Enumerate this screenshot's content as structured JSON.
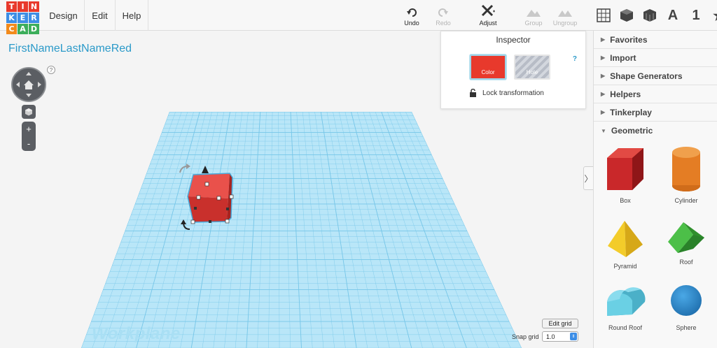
{
  "app": {
    "logo_letters": [
      "T",
      "I",
      "N",
      "K",
      "E",
      "R",
      "C",
      "A",
      "D"
    ],
    "logo_colors": [
      "#e8392c",
      "#e8392c",
      "#e8392c",
      "#3d8ee6",
      "#3d8ee6",
      "#3d8ee6",
      "#f28a1b",
      "#3cae5b",
      "#3cae5b"
    ],
    "menus": [
      "Design",
      "Edit",
      "Help"
    ]
  },
  "toolbar": {
    "undo": "Undo",
    "redo": "Redo",
    "adjust": "Adjust",
    "group": "Group",
    "ungroup": "Ungroup",
    "view_icons": [
      "grid-view-icon",
      "box-view-icon",
      "brick-icon"
    ],
    "text_tool": "A",
    "number_tool": "1",
    "favorite_icon": "★"
  },
  "design": {
    "title": "FirstNameLastNameRed"
  },
  "view_controls": {
    "help": "?",
    "zoom_in": "+",
    "zoom_out": "-"
  },
  "workplane": {
    "label": "Workplane",
    "color": "#b9e6f8",
    "line_color": "#76c6e8"
  },
  "inspector": {
    "title": "Inspector",
    "color_label": "Color",
    "hole_label": "Hole",
    "help": "?",
    "lock_label": "Lock transformation",
    "selected_color": "#e8392c"
  },
  "panel": {
    "sections": [
      "Favorites",
      "Import",
      "Shape Generators",
      "Helpers",
      "Tinkerplay",
      "Geometric"
    ],
    "shapes": [
      {
        "label": "Box",
        "color": "#d2282a"
      },
      {
        "label": "Cylinder",
        "color": "#e6781a"
      },
      {
        "label": "Pyramid",
        "color": "#f0c81e"
      },
      {
        "label": "Roof",
        "color": "#3ea83c"
      },
      {
        "label": "Round Roof",
        "color": "#5cc4da"
      },
      {
        "label": "Sphere",
        "color": "#2a8ed4"
      }
    ]
  },
  "grid": {
    "edit_label": "Edit grid",
    "snap_label": "Snap grid",
    "snap_value": "1.0"
  }
}
